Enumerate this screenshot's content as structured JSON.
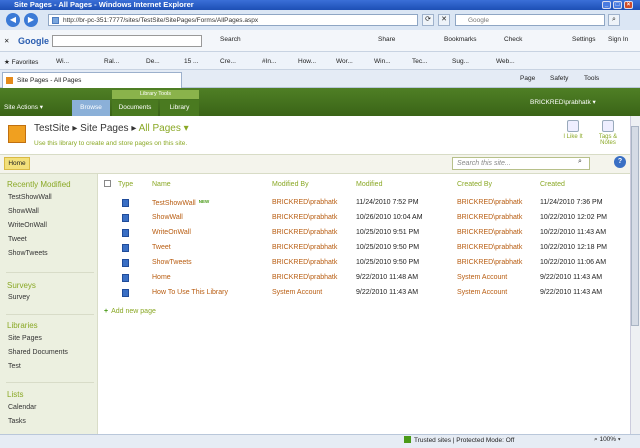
{
  "window": {
    "title": "Site Pages - All Pages - Windows Internet Explorer"
  },
  "browser": {
    "address": "http://br-pc-351:7777/sites/TestSite/SitePages/Forms/AllPages.aspx",
    "search_placeholder": "Google",
    "google_toolbar": {
      "logo": "Google",
      "search": "Search",
      "share": "Share",
      "bookmarks": "Bookmarks",
      "check": "Check",
      "settings": "Settings",
      "sign_in": "Sign In"
    },
    "favorites_label": "Favorites",
    "favorites": [
      "Wi...",
      "Ral...",
      "De...",
      "15 ...",
      "Cre...",
      "#In...",
      "How...",
      "Wor...",
      "Win...",
      "Tec...",
      "Sug...",
      "Web..."
    ],
    "tab": "Site Pages - All Pages",
    "commands": {
      "page": "Page",
      "safety": "Safety",
      "tools": "Tools"
    }
  },
  "ribbon": {
    "site_actions": "Site Actions",
    "tool_group": "Library Tools",
    "tabs": [
      "Browse",
      "Documents",
      "Library"
    ],
    "user": "BRICKRED\\prabhatk"
  },
  "header": {
    "site": "TestSite",
    "library": "Site Pages",
    "view": "All Pages",
    "description": "Use this library to create and store pages on this site.",
    "i_like_it": "I Like It",
    "tags_notes": "Tags & Notes"
  },
  "topnav": {
    "home": "Home",
    "search_placeholder": "Search this site..."
  },
  "quicklaunch": {
    "recently_modified": {
      "heading": "Recently Modified",
      "items": [
        "TestShowWall",
        "ShowWall",
        "WriteOnWall",
        "Tweet",
        "ShowTweets"
      ]
    },
    "surveys": {
      "heading": "Surveys",
      "items": [
        "Survey"
      ]
    },
    "libraries": {
      "heading": "Libraries",
      "items": [
        "Site Pages",
        "Shared Documents",
        "Test"
      ]
    },
    "lists": {
      "heading": "Lists",
      "items": [
        "Calendar",
        "Tasks"
      ]
    }
  },
  "table": {
    "columns": [
      "Type",
      "Name",
      "Modified By",
      "Modified",
      "Created By",
      "Created"
    ],
    "rows": [
      {
        "name": "TestShowWall",
        "is_new": true,
        "new_label": "NEW",
        "modified_by": "BRICKRED\\prabhatk",
        "modified": "11/24/2010 7:52 PM",
        "created_by": "BRICKRED\\prabhatk",
        "created": "11/24/2010 7:36 PM"
      },
      {
        "name": "ShowWall",
        "is_new": false,
        "modified_by": "BRICKRED\\prabhatk",
        "modified": "10/26/2010 10:04 AM",
        "created_by": "BRICKRED\\prabhatk",
        "created": "10/22/2010 12:02 PM"
      },
      {
        "name": "WriteOnWall",
        "is_new": false,
        "modified_by": "BRICKRED\\prabhatk",
        "modified": "10/25/2010 9:51 PM",
        "created_by": "BRICKRED\\prabhatk",
        "created": "10/22/2010 11:43 AM"
      },
      {
        "name": "Tweet",
        "is_new": false,
        "modified_by": "BRICKRED\\prabhatk",
        "modified": "10/25/2010 9:50 PM",
        "created_by": "BRICKRED\\prabhatk",
        "created": "10/22/2010 12:18 PM"
      },
      {
        "name": "ShowTweets",
        "is_new": false,
        "modified_by": "BRICKRED\\prabhatk",
        "modified": "10/25/2010 9:50 PM",
        "created_by": "BRICKRED\\prabhatk",
        "created": "10/22/2010 11:06 AM"
      },
      {
        "name": "Home",
        "is_new": false,
        "modified_by": "BRICKRED\\prabhatk",
        "modified": "9/22/2010 11:48 AM",
        "created_by": "System Account",
        "created": "9/22/2010 11:43 AM"
      },
      {
        "name": "How To Use This Library",
        "is_new": false,
        "modified_by": "System Account",
        "modified": "9/22/2010 11:43 AM",
        "created_by": "System Account",
        "created": "9/22/2010 11:43 AM"
      }
    ],
    "add_new": "Add new page"
  },
  "statusbar": {
    "zone": "Trusted sites | Protected Mode: Off",
    "zoom": "100%"
  },
  "colors": {
    "ribbon": "#3a6417",
    "accent_green": "#8aa825",
    "link_orange": "#b85c10"
  }
}
